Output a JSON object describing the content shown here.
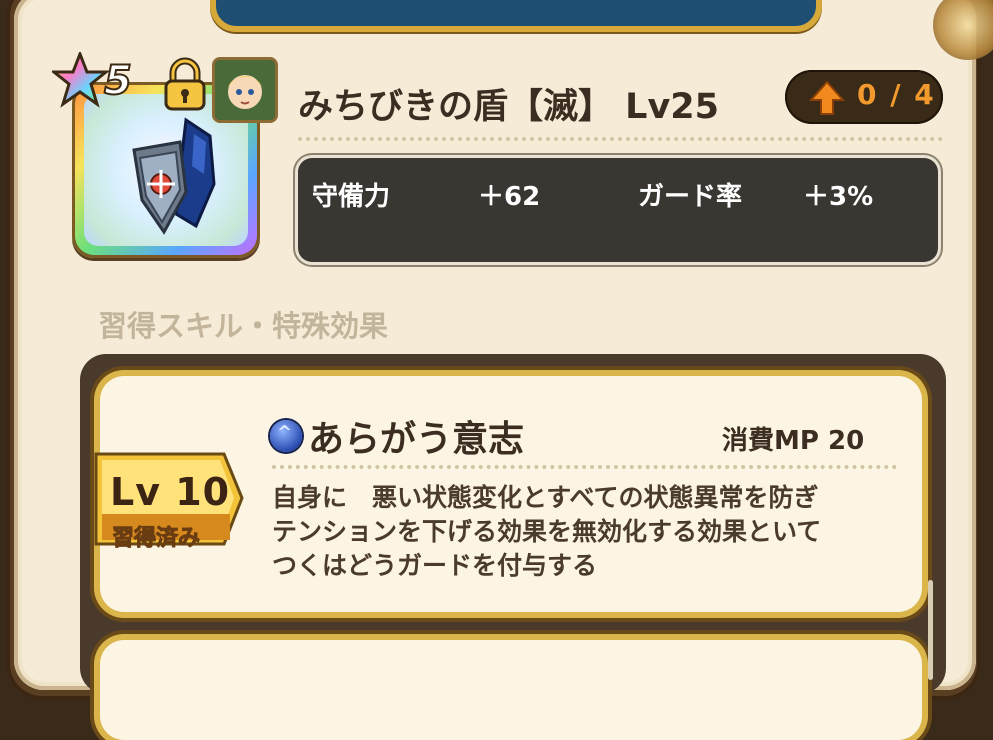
{
  "item": {
    "name": "みちびきの盾【滅】 Lv25",
    "rarity": "5",
    "upgrade": "0 / 4",
    "icon": "shield-icon"
  },
  "stats": [
    {
      "label": "守備力",
      "value": "＋62"
    },
    {
      "label": "ガード率",
      "value": "＋3%"
    }
  ],
  "section": {
    "label": "習得スキル・特殊効果"
  },
  "skill": {
    "name": "あらがう意志",
    "mp": "消費MP  20",
    "level": "Lv 10",
    "learned": "習得済み",
    "description": [
      "自身に　悪い状態変化とすべての状態異常を防ぎ",
      "テンションを下げる効果を無効化する効果といて",
      "つくはどうガードを付与する"
    ]
  },
  "colors": {
    "panel": "#f5ebd7",
    "stat_box": "#3a3733",
    "upgrade_text": "#f29a2e",
    "card_border": "#d9b54a"
  }
}
